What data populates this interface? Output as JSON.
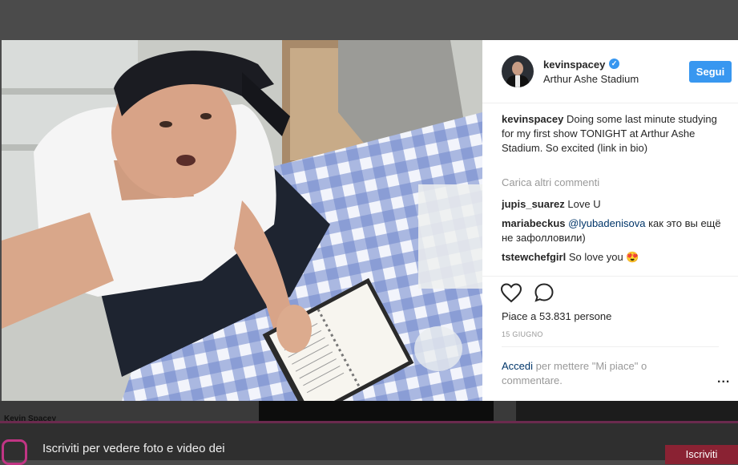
{
  "post": {
    "username": "kevinspacey",
    "location": "Arthur Ashe Stadium",
    "follow_label": "Segui",
    "caption": "Doing some last minute studying for my first show TONIGHT at Arthur Ashe Stadium. So excited (link in bio)",
    "load_more": "Carica altri commenti",
    "comments": [
      {
        "user": "jupis_suarez",
        "text": "Love U"
      },
      {
        "user": "mariabeckus",
        "mention": "@lyubadenisova",
        "text": "как это вы ещё не зафолловили)"
      },
      {
        "user": "tstewchefgirl",
        "text": "So love you 😍"
      }
    ],
    "likes": "Piace a 53.831 persone",
    "date": "15 GIUGNO",
    "login_link": "Accedi",
    "login_rest": "per mettere \"Mi piace\" o commentare.",
    "more": "..."
  },
  "background": {
    "profile_name": "Kevin Spacey",
    "signup_text": "Iscriviti per vedere foto e video dei",
    "signup_button": "Iscriviti"
  },
  "colors": {
    "accent": "#3897f0",
    "verified": "#3897f0",
    "signup_button": "#8a2233"
  },
  "icons": {
    "like": "heart-outline",
    "comment": "speech-bubble-outline",
    "verified": "blue-check-badge",
    "footer_logo": "instagram-logo"
  }
}
